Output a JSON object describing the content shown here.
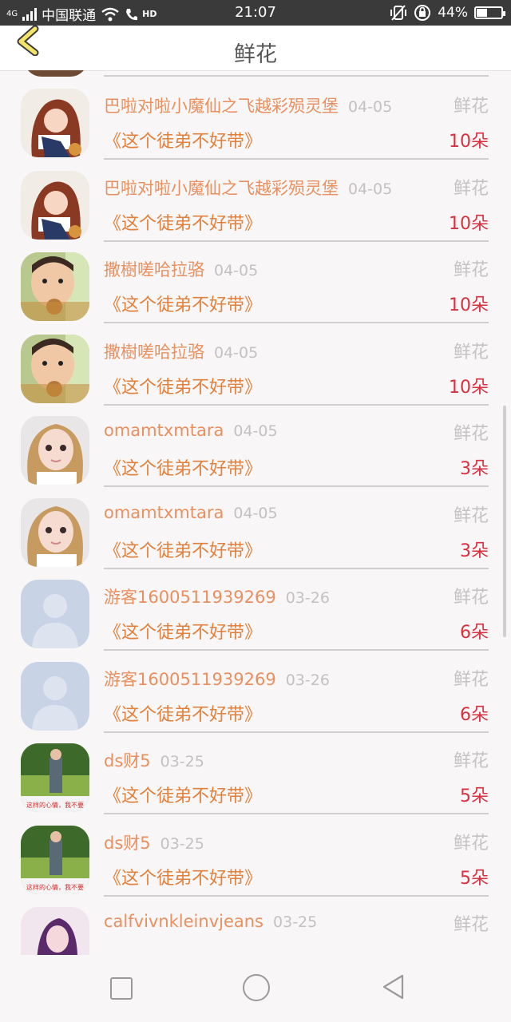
{
  "status_bar": {
    "network": "4G",
    "carrier": "中国联通",
    "hd": "HD",
    "time": "21:07",
    "battery": "44%",
    "battery_level": 0.44
  },
  "header": {
    "title": "鲜花"
  },
  "rows": [
    {
      "name": "巴啦对啦小魔仙之飞越彩殒灵堡",
      "date": "04-05",
      "kind": "鲜花",
      "book": "《这个徒弟不好带》",
      "count": "10朵",
      "avatar": "anime-girl"
    },
    {
      "name": "巴啦对啦小魔仙之飞越彩殒灵堡",
      "date": "04-05",
      "kind": "鲜花",
      "book": "《这个徒弟不好带》",
      "count": "10朵",
      "avatar": "anime-girl"
    },
    {
      "name": "撒樹嗟哈拉骆",
      "date": "04-05",
      "kind": "鲜花",
      "book": "《这个徒弟不好带》",
      "count": "10朵",
      "avatar": "child"
    },
    {
      "name": "撒樹嗟哈拉骆",
      "date": "04-05",
      "kind": "鲜花",
      "book": "《这个徒弟不好带》",
      "count": "10朵",
      "avatar": "child"
    },
    {
      "name": "omamtxmtara",
      "date": "04-05",
      "kind": "鲜花",
      "book": "《这个徒弟不好带》",
      "count": "3朵",
      "avatar": "woman"
    },
    {
      "name": "omamtxmtara",
      "date": "04-05",
      "kind": "鲜花",
      "book": "《这个徒弟不好带》",
      "count": "3朵",
      "avatar": "woman"
    },
    {
      "name": "游客1600511939269",
      "date": "03-26",
      "kind": "鲜花",
      "book": "《这个徒弟不好带》",
      "count": "6朵",
      "avatar": "default"
    },
    {
      "name": "游客1600511939269",
      "date": "03-26",
      "kind": "鲜花",
      "book": "《这个徒弟不好带》",
      "count": "6朵",
      "avatar": "default"
    },
    {
      "name": "ds财5",
      "date": "03-25",
      "kind": "鲜花",
      "book": "《这个徒弟不好带》",
      "count": "5朵",
      "avatar": "outdoor"
    },
    {
      "name": "ds财5",
      "date": "03-25",
      "kind": "鲜花",
      "book": "《这个徒弟不好带》",
      "count": "5朵",
      "avatar": "outdoor"
    },
    {
      "name": "calfvivnkleinvjeans",
      "date": "03-25",
      "kind": "鲜花",
      "book": "",
      "count": "",
      "avatar": "purple"
    }
  ],
  "avatar_overlay_text": "这样的心情，我不要",
  "colors": {
    "name": "#e89060",
    "book": "#e0823e",
    "count": "#d93040",
    "date": "#c2c2c2",
    "kind": "#c4c4c4"
  },
  "nav": {
    "icons": [
      "square-icon",
      "circle-icon",
      "back-triangle-icon"
    ]
  }
}
